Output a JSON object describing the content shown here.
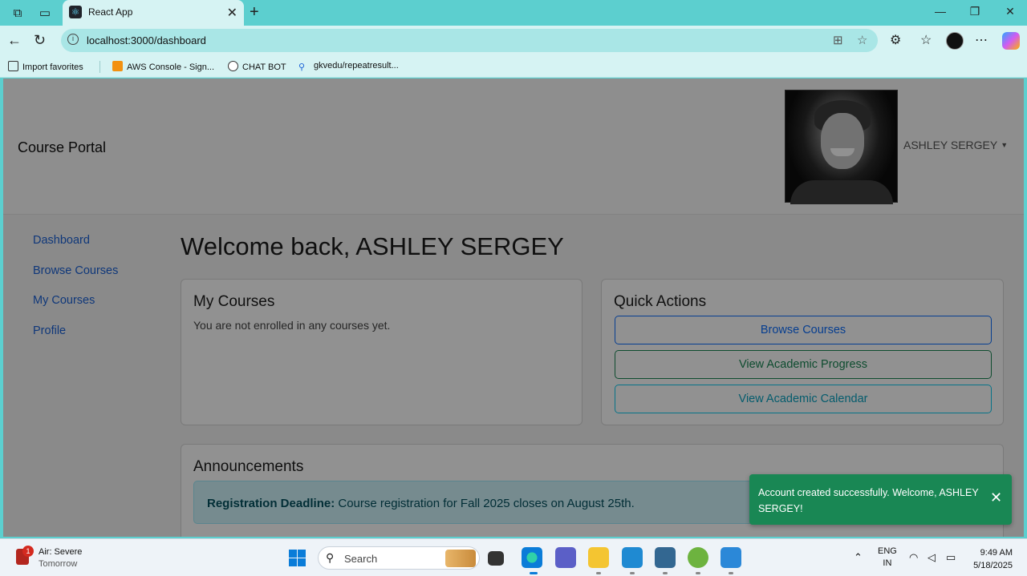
{
  "browser": {
    "tab_title": "React App",
    "url": "localhost:3000/dashboard",
    "bookmarks": [
      {
        "label": "Import favorites"
      },
      {
        "label": "AWS Console - Sign..."
      },
      {
        "label": "CHAT BOT"
      },
      {
        "label": "gkvedu/repeatresult..."
      }
    ]
  },
  "app": {
    "brand": "Course Portal",
    "user_name": "ASHLEY SERGEY",
    "nav": [
      {
        "label": "Dashboard"
      },
      {
        "label": "Browse Courses"
      },
      {
        "label": "My Courses"
      },
      {
        "label": "Profile"
      }
    ],
    "welcome": "Welcome back, ASHLEY SERGEY",
    "my_courses": {
      "title": "My Courses",
      "empty_text": "You are not enrolled in any courses yet."
    },
    "quick_actions": {
      "title": "Quick Actions",
      "buttons": [
        {
          "label": "Browse Courses",
          "color": "#0d6efd"
        },
        {
          "label": "View Academic Progress",
          "color": "#198754"
        },
        {
          "label": "View Academic Calendar",
          "color": "#0dcaf0"
        }
      ]
    },
    "announcements": {
      "title": "Announcements",
      "items": [
        {
          "heading": "Registration Deadline:",
          "text": " Course registration for Fall 2025 closes on August 25th."
        }
      ]
    },
    "toast": {
      "message": "Account created successfully. Welcome, ASHLEY SERGEY!",
      "close": "✕",
      "color": "#198754"
    }
  },
  "taskbar": {
    "weather_badge": "1",
    "weather_title": "Air: Severe",
    "weather_sub": "Tomorrow",
    "search_placeholder": "Search",
    "lang_top": "ENG",
    "lang_bottom": "IN",
    "time": "9:49 AM",
    "date": "5/18/2025"
  },
  "colors": {
    "browser_chrome": "#5ccfcf",
    "link": "#1b62d6",
    "primary": "#0d6efd",
    "success": "#198754",
    "info": "#0dcaf0"
  }
}
